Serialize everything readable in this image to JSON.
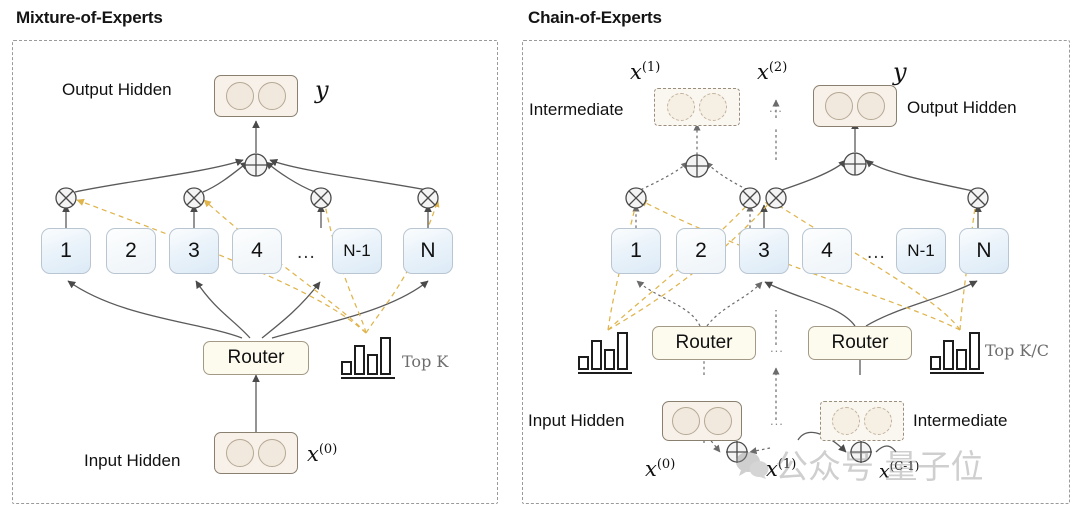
{
  "figure": {
    "kind": "architecture-diagram",
    "panels": [
      {
        "id": "moe",
        "title": "Mixture-of-Experts",
        "labels": {
          "output_hidden": "Output Hidden",
          "input_hidden": "Input Hidden",
          "router": "Router",
          "topk": "Top K",
          "ellipsis": "..."
        },
        "math": {
          "output": "y",
          "input": "x(0)",
          "input_base": "x",
          "input_sup": "(0)"
        },
        "experts": [
          "1",
          "2",
          "3",
          "4",
          "...",
          "N-1",
          "N"
        ],
        "active_experts": [
          "1",
          "3",
          "N-1",
          "N"
        ],
        "routers": [
          "Router"
        ],
        "barchart": {
          "values": [
            38,
            78,
            55,
            100
          ],
          "label": "Top K"
        }
      },
      {
        "id": "coe",
        "title": "Chain-of-Experts",
        "labels": {
          "intermediate_top": "Intermediate",
          "intermediate_bottom": "Intermediate",
          "output_hidden": "Output Hidden",
          "input_hidden": "Input Hidden",
          "router_left": "Router",
          "router_right": "Router",
          "topk": "Top K/C",
          "ellipsis_top": "...",
          "ellipsis_mid": "...",
          "ellipsis_bottom": "...",
          "ellipsis_experts": "..."
        },
        "math": {
          "x1_base": "x",
          "x1_sup": "(1)",
          "x2_base": "x",
          "x2_sup": "(2)",
          "output": "y",
          "x0_base": "x",
          "x0_sup": "(0)",
          "x1b_base": "x",
          "x1b_sup": "(1)",
          "xc_base": "x",
          "xc_sup": "(C-1)"
        },
        "experts": [
          "1",
          "2",
          "3",
          "4",
          "...",
          "N-1",
          "N"
        ],
        "routers": [
          "Router",
          "Router"
        ],
        "barcharts": [
          {
            "values": [
              38,
              78,
              55,
              100
            ]
          },
          {
            "values": [
              38,
              78,
              55,
              100
            ],
            "label": "Top K/C"
          }
        ]
      }
    ],
    "operators": {
      "add": "⊕",
      "multiply": "⊗"
    },
    "watermark": {
      "text": "公众号 量子位",
      "logo": "wechat-icon"
    },
    "colors": {
      "expert_fill": "#e3eff9",
      "expert_stroke": "#b9c6d2",
      "hidden_fill": "#f7f1e9",
      "hidden_stroke": "#8a8070",
      "router_fill": "#fdfaee",
      "router_stroke": "#a39a86",
      "wire_solid": "#5a5a5a",
      "wire_dashed_gold": "#e0b84e",
      "panel_border": "#9a9a9a"
    }
  }
}
